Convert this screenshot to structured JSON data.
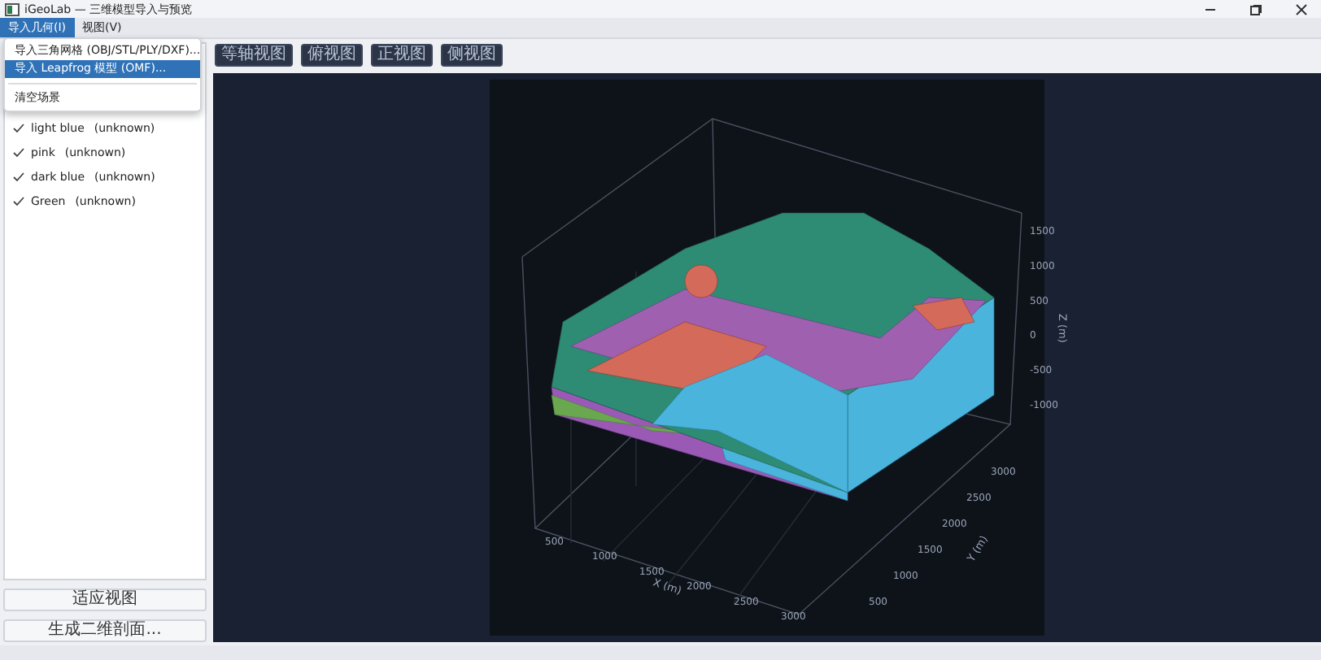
{
  "window": {
    "title": "iGeoLab — 三维模型导入与预览"
  },
  "menu_bar": [
    {
      "label": "导入几何(I)",
      "selected": true
    },
    {
      "label": "视图(V)",
      "selected": false
    }
  ],
  "dropdown": [
    {
      "label": "导入三角网格 (OBJ/STL/PLY/DXF)...",
      "selected": false
    },
    {
      "label": "导入 Leapfrog 模型 (OMF)...",
      "selected": true
    },
    {
      "label": "清空场景",
      "selected": false
    }
  ],
  "layers": [
    {
      "name": "light blue",
      "status": "(unknown)",
      "checked": true
    },
    {
      "name": "pink",
      "status": "(unknown)",
      "checked": true
    },
    {
      "name": "dark blue",
      "status": "(unknown)",
      "checked": true
    },
    {
      "name": "Green",
      "status": "(unknown)",
      "checked": true
    }
  ],
  "side_buttons": [
    "适应视图",
    "生成二维剖面..."
  ],
  "toolbar": [
    "等轴视图",
    "俯视图",
    "正视图",
    "侧视图"
  ],
  "plot": {
    "z_axis": {
      "label": "Z (m)",
      "ticks": [
        "1500",
        "1000",
        "500",
        "0",
        "-500",
        "-1000"
      ]
    },
    "x_axis": {
      "label": "X (m)",
      "ticks": [
        "500",
        "1000",
        "1500",
        "2000",
        "2500",
        "3000"
      ]
    },
    "y_axis": {
      "label": "Y (m)",
      "ticks": [
        "500",
        "1000",
        "1500",
        "2000",
        "2500",
        "3000"
      ]
    }
  }
}
